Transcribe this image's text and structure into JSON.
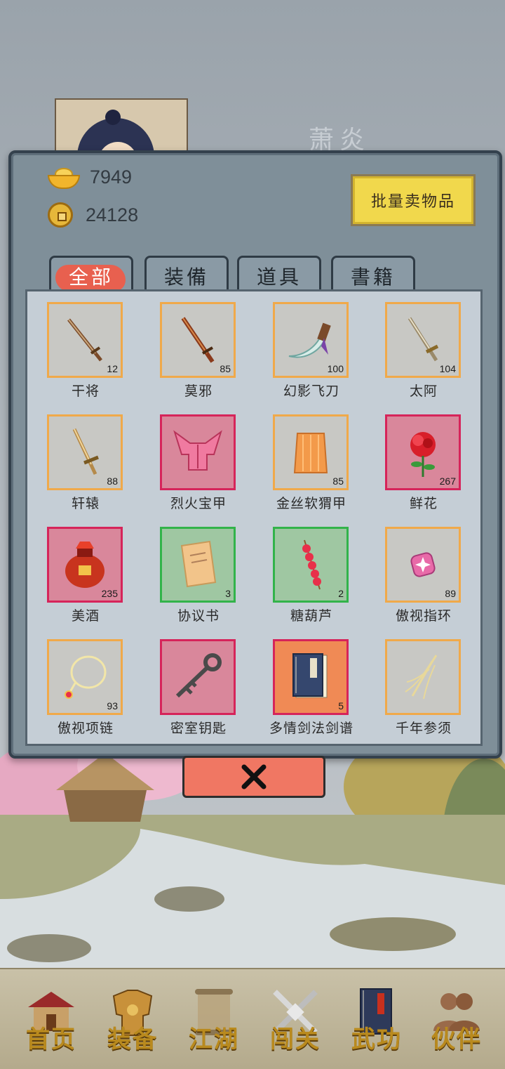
{
  "currencies": {
    "gold": "7949",
    "coins": "24128"
  },
  "sell_button_label": "批量卖物品",
  "tabs": [
    {
      "label": "全部",
      "active": true
    },
    {
      "label": "装備",
      "active": false
    },
    {
      "label": "道具",
      "active": false
    },
    {
      "label": "書籍",
      "active": false
    }
  ],
  "items": [
    {
      "name": "干将",
      "count": "12",
      "rarity": "orange",
      "icon": "sword-icon"
    },
    {
      "name": "莫邪",
      "count": "85",
      "rarity": "orange",
      "icon": "sword-icon"
    },
    {
      "name": "幻影飞刀",
      "count": "100",
      "rarity": "orange",
      "icon": "dagger-icon"
    },
    {
      "name": "太阿",
      "count": "104",
      "rarity": "orange",
      "icon": "sword-icon"
    },
    {
      "name": "轩辕",
      "count": "88",
      "rarity": "orange",
      "icon": "sword-icon"
    },
    {
      "name": "烈火宝甲",
      "count": "",
      "rarity": "red",
      "icon": "armor-icon"
    },
    {
      "name": "金丝软猬甲",
      "count": "85",
      "rarity": "orange",
      "icon": "vest-icon"
    },
    {
      "name": "鲜花",
      "count": "267",
      "rarity": "red",
      "icon": "rose-icon"
    },
    {
      "name": "美酒",
      "count": "235",
      "rarity": "red",
      "icon": "wine-jar-icon"
    },
    {
      "name": "协议书",
      "count": "3",
      "rarity": "green",
      "icon": "scroll-icon"
    },
    {
      "name": "糖葫芦",
      "count": "2",
      "rarity": "green",
      "icon": "candied-haws-icon"
    },
    {
      "name": "傲视指环",
      "count": "89",
      "rarity": "orange",
      "icon": "ring-icon"
    },
    {
      "name": "傲视项链",
      "count": "93",
      "rarity": "orange",
      "icon": "necklace-icon"
    },
    {
      "name": "密室钥匙",
      "count": "",
      "rarity": "red",
      "icon": "key-icon"
    },
    {
      "name": "多情剑法剑谱",
      "count": "5",
      "rarity": "book",
      "icon": "book-icon"
    },
    {
      "name": "千年参须",
      "count": "",
      "rarity": "orange",
      "icon": "ginseng-icon"
    }
  ],
  "nav": [
    {
      "label": "首页",
      "icon": "house-icon"
    },
    {
      "label": "装备",
      "icon": "armor-icon"
    },
    {
      "label": "江湖",
      "icon": "scroll-icon"
    },
    {
      "label": "闯关",
      "icon": "crossed-swords-icon"
    },
    {
      "label": "武功",
      "icon": "book-icon"
    },
    {
      "label": "伙伴",
      "icon": "partners-icon"
    }
  ],
  "colors": {
    "panel": "#7f8f99",
    "gold_button": "#f1d84c",
    "active_tab": "#e8604f",
    "close_button": "#f07763",
    "rarity_orange": "#f0a94a",
    "rarity_red": "#d6245a",
    "rarity_green": "#32b34a"
  }
}
